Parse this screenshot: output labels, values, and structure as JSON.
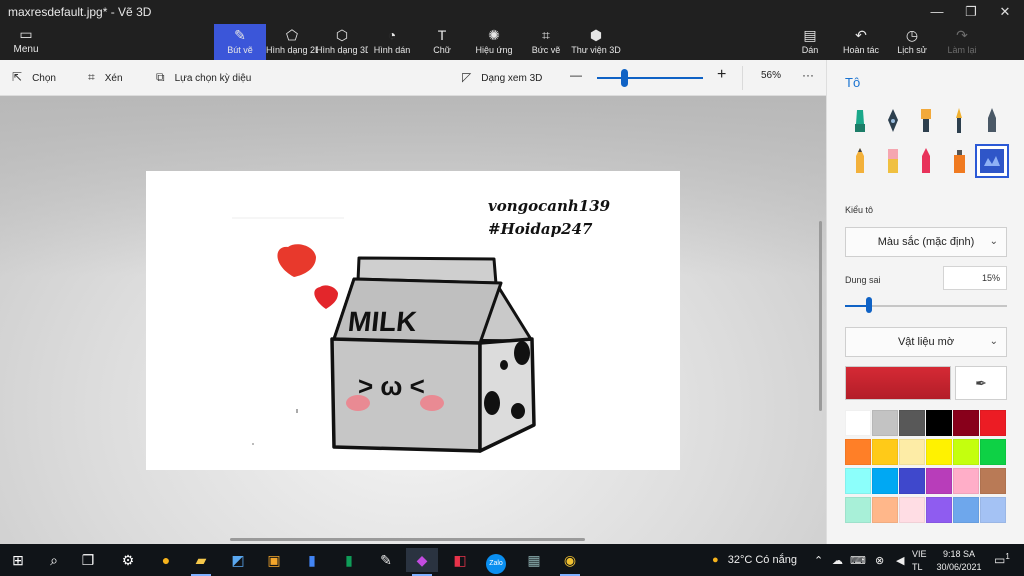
{
  "window": {
    "title": "maxresdefault.jpg* - Vẽ 3D",
    "minimize": "—",
    "maximize": "❐",
    "close": "✕"
  },
  "ribbon": {
    "menu": {
      "label": "Menu",
      "icon": "folder-icon"
    },
    "tools": [
      {
        "label": "Bút vẽ",
        "icon": "brush-icon",
        "active": true
      },
      {
        "label": "Hình dạng 2D",
        "icon": "shapes-2d-icon",
        "active": false
      },
      {
        "label": "Hình dạng 3D",
        "icon": "cube-icon",
        "active": false
      },
      {
        "label": "Hình dán",
        "icon": "sticker-icon",
        "active": false
      },
      {
        "label": "Chữ",
        "icon": "text-icon",
        "active": false
      },
      {
        "label": "Hiệu ứng",
        "icon": "effects-icon",
        "active": false
      },
      {
        "label": "Bức vẽ",
        "icon": "canvas-icon",
        "active": false
      },
      {
        "label": "Thư viện 3D",
        "icon": "library-3d-icon",
        "active": false
      }
    ],
    "right": [
      {
        "label": "Dán",
        "icon": "paste-icon",
        "disabled": false
      },
      {
        "label": "Hoàn tác",
        "icon": "undo-icon",
        "disabled": false
      },
      {
        "label": "Lịch sử",
        "icon": "history-icon",
        "disabled": false
      },
      {
        "label": "Làm lại",
        "icon": "redo-icon",
        "disabled": true
      }
    ]
  },
  "toolbar": {
    "select": "Chọn",
    "crop": "Xén",
    "magic_select": "Lựa chọn kỳ diệu",
    "view_3d": "Dạng xem 3D",
    "zoom_out": "—",
    "zoom_in": "+",
    "zoom": "56%",
    "zoom_fraction": 0.25,
    "more": "···"
  },
  "canvas_image": {
    "text_line1": "vongocanh139",
    "text_line2": "#Hoidap247",
    "carton_label": "MILK",
    "face": "> ω <"
  },
  "panel": {
    "title": "Tô",
    "brushes": [
      "marker-icon",
      "calligraphy-pen-icon",
      "oil-brush-icon",
      "watercolor-icon",
      "pixel-pen-icon",
      "pencil-icon",
      "eraser-icon",
      "crayon-icon",
      "spray-can-icon",
      "fill-icon"
    ],
    "selected_brush": 9,
    "fill_style_label": "Kiểu tô",
    "fill_style_value": "Màu sắc (mặc định)",
    "tolerance_label": "Dung sai",
    "tolerance_value": "15%",
    "tolerance_fraction": 0.15,
    "material_value": "Vật liệu mờ",
    "current_color": "#d52a35",
    "palette": [
      "#ffffff",
      "#c3c3c3",
      "#585858",
      "#000000",
      "#88001b",
      "#ec1c24",
      "#ff7f27",
      "#ffca18",
      "#fdeca6",
      "#fff200",
      "#c4ff0e",
      "#0ed145",
      "#8cfffb",
      "#00a8f3",
      "#3f48cc",
      "#b83dba",
      "#ffaec8",
      "#b97a56",
      "#a8f0d8",
      "#ffb78a",
      "#ffdde4",
      "#8f5cf0",
      "#6ea7ec",
      "#a4c2f4"
    ]
  },
  "taskbar": {
    "apps": [
      "windows-start-icon",
      "search-icon",
      "task-view-icon",
      "settings-icon",
      "weather-app-icon",
      "file-explorer-icon",
      "sticky-notes-icon",
      "photos-icon",
      "google-docs-icon",
      "google-sheets-icon",
      "paint-icon",
      "paint-3d-icon",
      "app-red-icon",
      "zalo-icon",
      "calculator-icon",
      "chrome-icon"
    ],
    "zalo_text": "Zalo",
    "weather": "32°C  Có nắng",
    "lang_line1": "VIE",
    "lang_line2": "TL",
    "time": "9:18 SA",
    "date": "30/06/2021",
    "notifications": "1"
  }
}
